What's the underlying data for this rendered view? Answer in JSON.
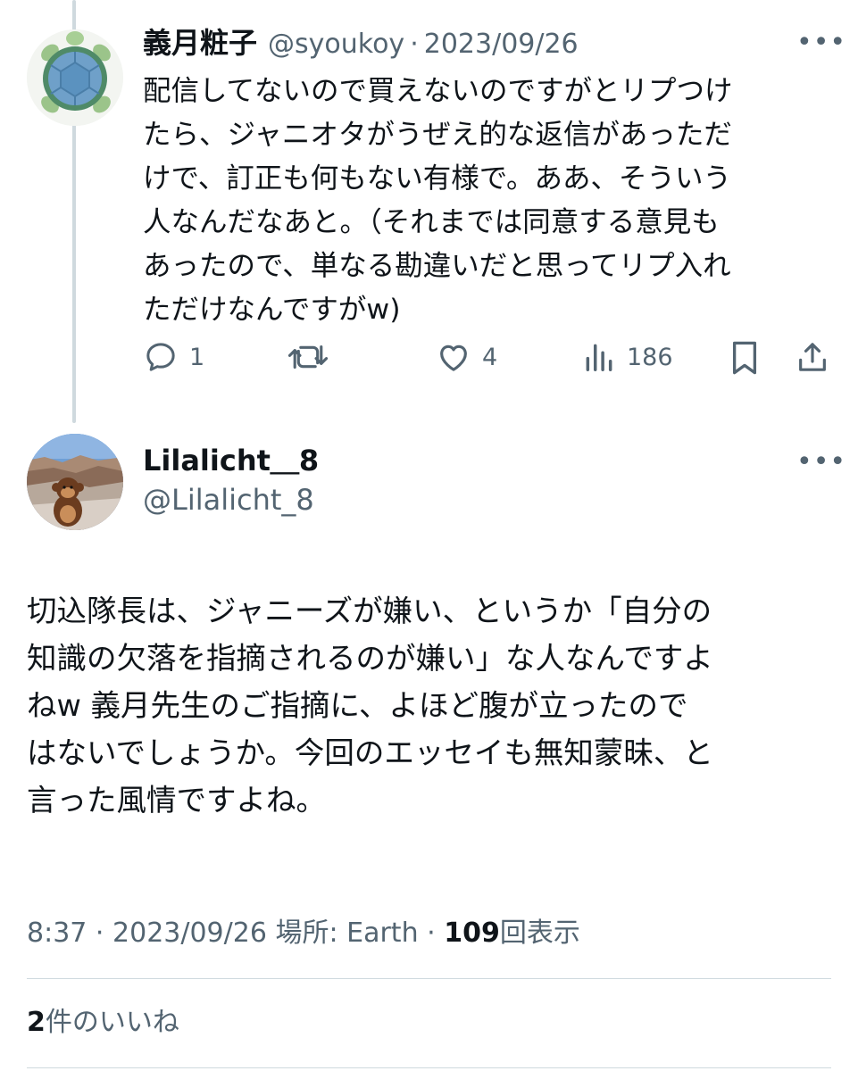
{
  "tweet1": {
    "display_name": "義月粧子",
    "handle": "@syoukoy",
    "separator": "·",
    "date": "2023/09/26",
    "more_label": "•••",
    "lines": [
      "配信してないので買えないのですがとリプつけ",
      "たら、ジャニオタがうぜえ的な返信があっただ",
      "けで、訂正も何もない有様で。ああ、そういう",
      "人なんだなあと。（それまでは同意する意見も",
      "あったので、単なる勘違いだと思ってリプ入れ",
      "ただけなんですがw)"
    ],
    "actions": {
      "reply_icon": "reply-icon",
      "reply_count": "1",
      "retweet_icon": "retweet-icon",
      "like_icon": "heart-icon",
      "like_count": "4",
      "views_icon": "bar-chart-icon",
      "view_count": "186",
      "bookmark_icon": "bookmark-icon",
      "share_icon": "share-icon"
    }
  },
  "tweet2": {
    "display_name": "Lilalicht＿8",
    "handle": "@Lilalicht_8",
    "more_label": "•••",
    "lines": [
      "切込隊長は、ジャニーズが嫌い、というか「自分の",
      "知識の欠落を指摘されるのが嫌い」な人なんですよ",
      "ねw 義月先生のご指摘に、よほど腹が立ったので",
      "はないでしょうか。今回のエッセイも無知蒙昧、と",
      "言った風情ですよね。"
    ],
    "meta": {
      "time": "8:37",
      "separator": "·",
      "date": "2023/09/26",
      "location_label": "場所: Earth",
      "views_count": "109",
      "views_label": "回表示"
    },
    "likes": {
      "count": "2",
      "label": "件のいいね"
    }
  },
  "colors": {
    "text": "#0f1419",
    "muted": "#536471",
    "divider": "#cfd9de"
  }
}
